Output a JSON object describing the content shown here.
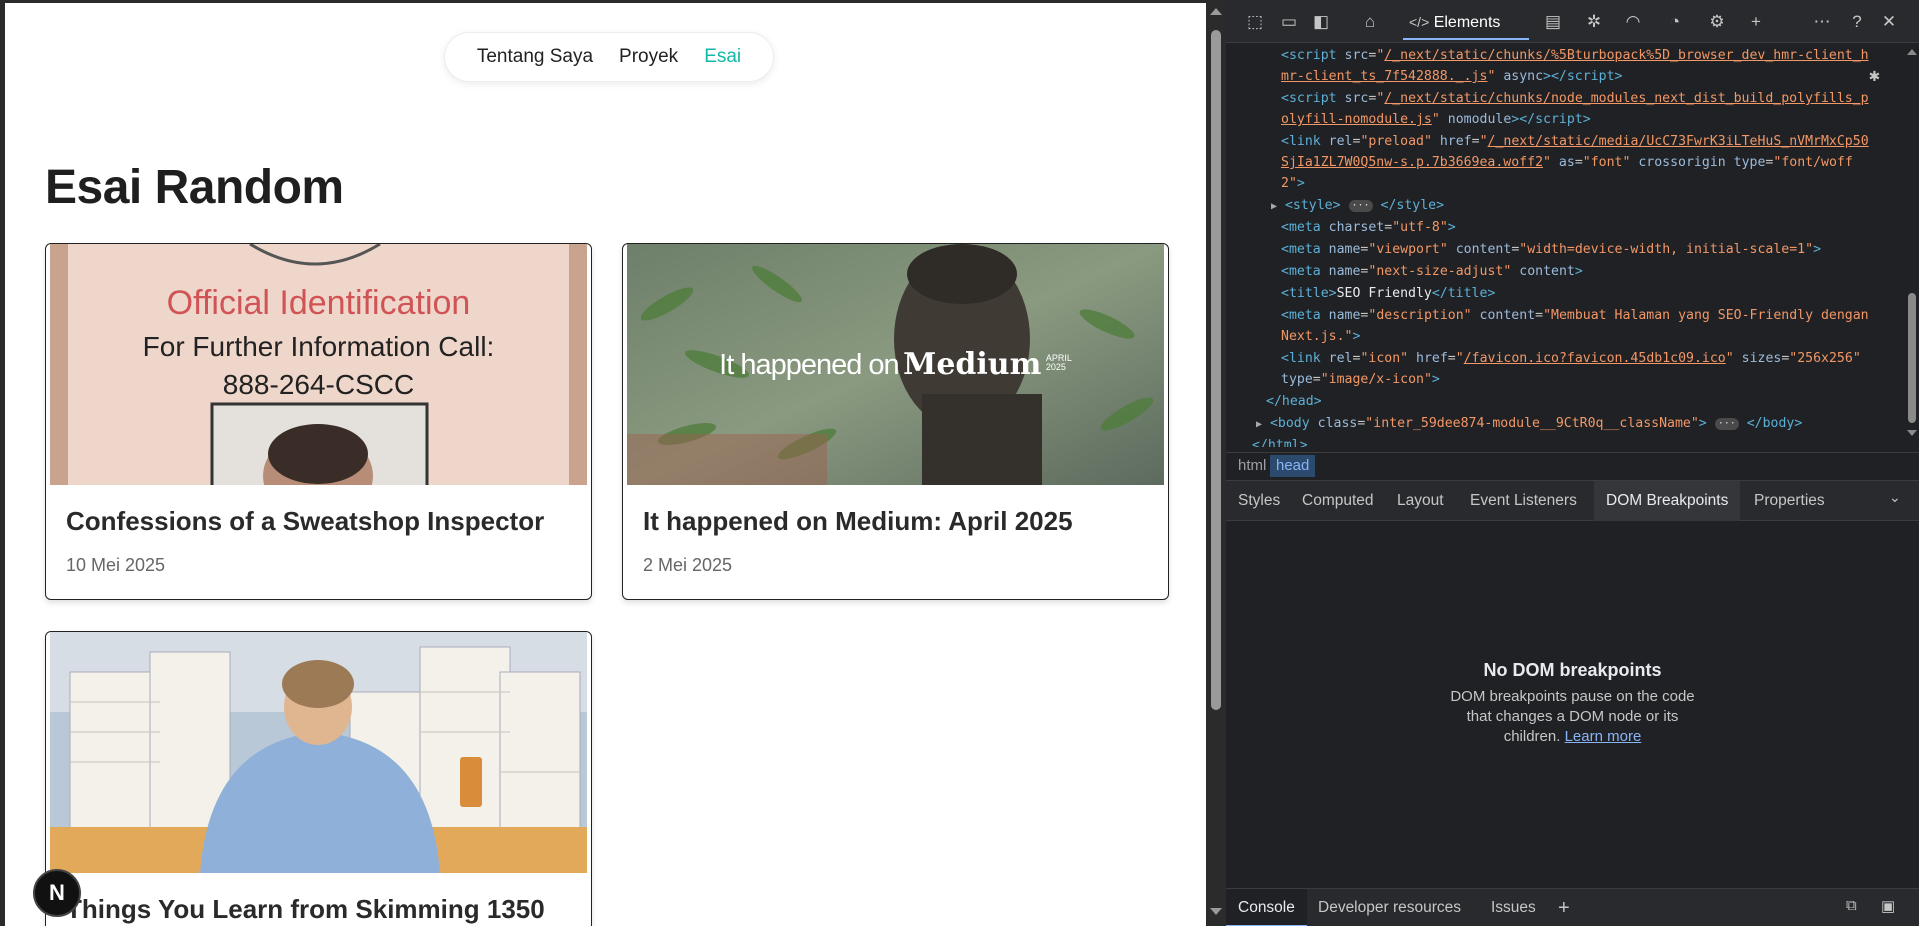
{
  "nav": {
    "items": [
      "Tentang Saya",
      "Proyek",
      "Esai"
    ],
    "active_index": 2
  },
  "page": {
    "title": "Esai Random"
  },
  "cards": [
    {
      "title": "Confessions of a Sweatshop Inspector",
      "date": "10 Mei 2025",
      "image_text": {
        "line1": "Official Identification",
        "line2": "For Further Information Call:",
        "line3": "888-264-CSCC"
      }
    },
    {
      "title": "It happened on Medium: April 2025",
      "date": "2 Mei 2025",
      "image_text": {
        "lead": "It happened on",
        "brand": "Medium",
        "month": "APRIL",
        "year": "2025"
      }
    },
    {
      "title": "Things You Learn from Skimming 1350",
      "date": ""
    }
  ],
  "next_button": {
    "label": "N"
  },
  "devtools": {
    "active_tool": "Elements",
    "dom_lines": {
      "l1_src": "/_next/static/chunks/%5Bturbopack%5D_browser_dev_hmr-client_h",
      "l1_src2": "mr-client_ts_7f542888._.js",
      "l2_src": "/_next/static/chunks/node_modules_next_dist_build_polyfills_p",
      "l2_src2": "olyfill-nomodule.js",
      "l3_href": "/_next/static/media/UcC73FwrK3iLTeHuS_nVMrMxCp50",
      "l3_href2": "SjIa1ZL7W0Q5nw-s.p.7b3669ea.woff2",
      "viewport": "width=device-width, initial-scale=1",
      "title": "SEO Friendly",
      "description": "Membuat Halaman yang SEO-Friendly dengan",
      "description2": "Next.js.",
      "icon_href": "/favicon.ico?favicon.45db1c09.ico",
      "icon_sizes": "256x256",
      "icon_type": "image/x-icon",
      "body_class": "inter_59dee874-module__9CtR0q__className"
    },
    "breadcrumbs": [
      "html",
      "head"
    ],
    "panel_tabs": [
      "Styles",
      "Computed",
      "Layout",
      "Event Listeners",
      "DOM Breakpoints",
      "Properties"
    ],
    "active_panel_tab": "DOM Breakpoints",
    "empty_state": {
      "title": "No DOM breakpoints",
      "body": "DOM breakpoints pause on the code that changes a DOM node or its children.",
      "link": "Learn more"
    },
    "drawer_tabs": [
      "Console",
      "Developer resources",
      "Issues"
    ]
  }
}
